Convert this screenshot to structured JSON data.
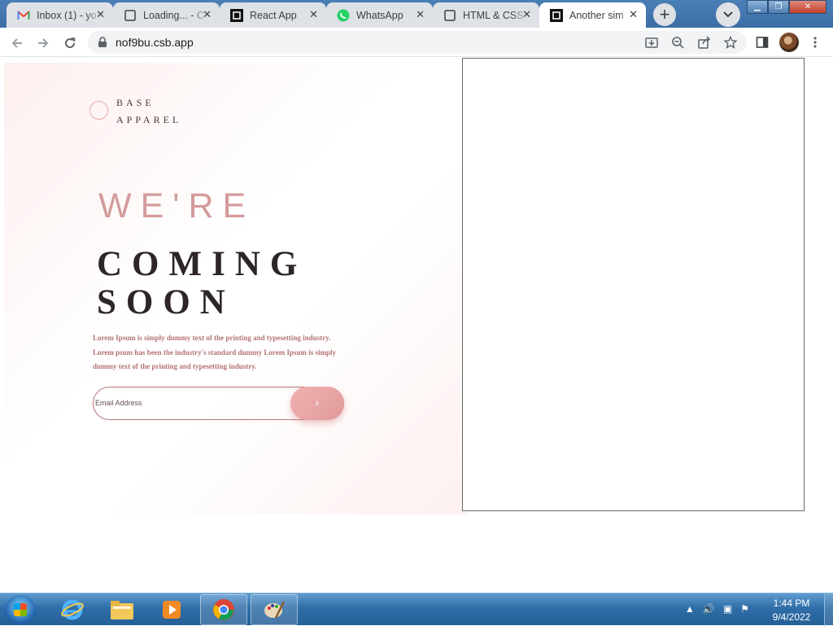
{
  "browser": {
    "tabs": [
      {
        "title": "Inbox (1) - yo",
        "favicon": "gmail-icon",
        "active": false
      },
      {
        "title": "Loading... - C",
        "favicon": "page-icon",
        "active": false
      },
      {
        "title": "React App",
        "favicon": "codesandbox-icon",
        "active": false
      },
      {
        "title": "WhatsApp",
        "favicon": "whatsapp-icon",
        "active": false
      },
      {
        "title": "HTML & CSS",
        "favicon": "page-icon",
        "active": false
      },
      {
        "title": "Another sim",
        "favicon": "codesandbox-icon",
        "active": true
      }
    ],
    "url": "nof9bu.csb.app"
  },
  "page": {
    "logo": {
      "line1": "BASE",
      "line2": "APPAREL"
    },
    "headline": {
      "line1": "WE'RE",
      "line2": "COMING",
      "line3": "SOON"
    },
    "description": "Lorem Ipsum is simply dummy text of the printing and typesetting industry. Lorem psum has been the industry's standard dummy Lorem Ipsum is simply dummy text of the printing and typesetting industry.",
    "email": {
      "placeholder": "Email Address",
      "submit_glyph": "›"
    },
    "colors": {
      "accent": "#d49b9b",
      "text_dark": "#2e2626",
      "body_text": "#b47373"
    }
  },
  "taskbar": {
    "time": "1:44 PM",
    "date": "9/4/2022",
    "apps": [
      "internet-explorer-icon",
      "file-explorer-icon",
      "media-player-icon",
      "chrome-icon",
      "paint-icon"
    ]
  }
}
